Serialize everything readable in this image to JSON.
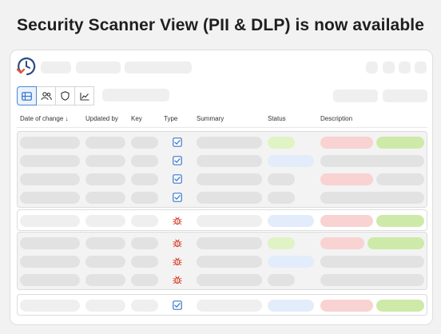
{
  "headline": "Security Scanner View (PII & DLP) is now available",
  "logo": {
    "icon": "clock-history-icon",
    "colors": {
      "outline": "#2b4a86",
      "arrow": "#e45a3b"
    }
  },
  "toolbar": {
    "views": [
      {
        "icon": "table-icon",
        "active": true
      },
      {
        "icon": "users-icon",
        "active": false
      },
      {
        "icon": "shield-icon",
        "active": false
      },
      {
        "icon": "trend-chart-icon",
        "active": false
      }
    ]
  },
  "columns": {
    "date": "Date of change ↓",
    "updated_by": "Updated by",
    "key": "Key",
    "type": "Type",
    "summary": "Summary",
    "status": "Status",
    "description": "Description"
  },
  "groups": [
    {
      "style": "dimmed",
      "rows": [
        {
          "type": "checkbox-icon",
          "status": "green",
          "description": [
            "red",
            "green"
          ]
        },
        {
          "type": "checkbox-icon",
          "status": "blue",
          "description": [
            "grey"
          ]
        },
        {
          "type": "checkbox-icon",
          "status": "grey",
          "description": [
            "red",
            "grey"
          ]
        },
        {
          "type": "checkbox-icon",
          "status": "grey",
          "description": [
            "grey"
          ]
        }
      ]
    },
    {
      "style": "highlighted",
      "rows": [
        {
          "type": "bug-icon",
          "status": "blue",
          "description": [
            "red",
            "green"
          ]
        }
      ]
    },
    {
      "style": "dimmed",
      "rows": [
        {
          "type": "bug-icon",
          "status": "green",
          "description": [
            "red",
            "green"
          ]
        },
        {
          "type": "bug-icon",
          "status": "blue",
          "description": [
            "grey"
          ]
        },
        {
          "type": "bug-icon",
          "status": "grey",
          "description": [
            "grey"
          ]
        }
      ]
    },
    {
      "style": "highlighted",
      "rows": [
        {
          "type": "checkbox-icon",
          "status": "blue",
          "description": [
            "red",
            "green"
          ]
        }
      ]
    }
  ],
  "colors": {
    "accent": "#4a8ad8",
    "status_green": "#dff3c4",
    "status_blue": "#e3ecfa",
    "desc_red": "#f9d2d2",
    "desc_green": "#cdeaa8",
    "bug": "#d9412e",
    "checkbox": "#3b78c9"
  }
}
